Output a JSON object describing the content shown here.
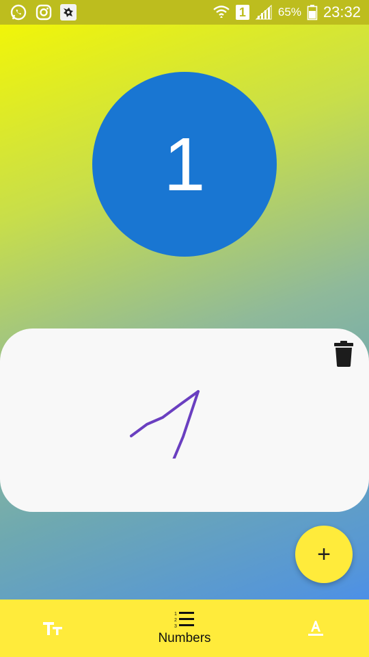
{
  "status_bar": {
    "left_icons": [
      "whatsapp-icon",
      "instagram-icon",
      "app-thumbnail-icon"
    ],
    "sim_label": "1",
    "battery_percent": "65%",
    "time": "23:32"
  },
  "main": {
    "number": "1"
  },
  "card": {
    "delete_icon": "trash-icon",
    "drawing_stroke_color": "#6a3fc0"
  },
  "fab": {
    "label": "+"
  },
  "bottom_nav": {
    "items": [
      {
        "icon": "text-size-icon",
        "label": ""
      },
      {
        "icon": "numbered-list-icon",
        "label": "Numbers"
      },
      {
        "icon": "text-color-icon",
        "label": ""
      }
    ]
  },
  "colors": {
    "accent_yellow": "#ffeb3b",
    "circle_blue": "#1976d2",
    "status_bar": "#bdbd1e"
  }
}
